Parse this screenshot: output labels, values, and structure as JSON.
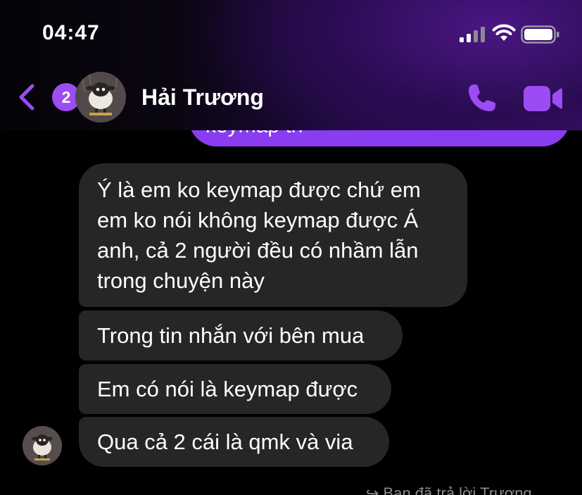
{
  "status_bar": {
    "time": "04:47"
  },
  "header": {
    "back_badge": "2",
    "contact_name": "Hải Trương",
    "accent_color": "#9b4cf2"
  },
  "conversation": {
    "outgoing_partial_text": "keymap   th",
    "incoming_messages": [
      {
        "lines": [
          "Ý là em ko keymap được chứ em",
          "em ko nói không keymap được Á",
          "anh, cả 2 người đều có nhầm lẫn",
          "trong chuyện này"
        ]
      },
      {
        "lines": [
          "Trong tin nhắn với bên mua"
        ]
      },
      {
        "lines": [
          "Em có nói là keymap được"
        ]
      },
      {
        "lines": [
          "Qua cả 2 cái là qmk và via"
        ]
      }
    ],
    "reply_note": "↪ Bạn đã trả lời Trương"
  }
}
